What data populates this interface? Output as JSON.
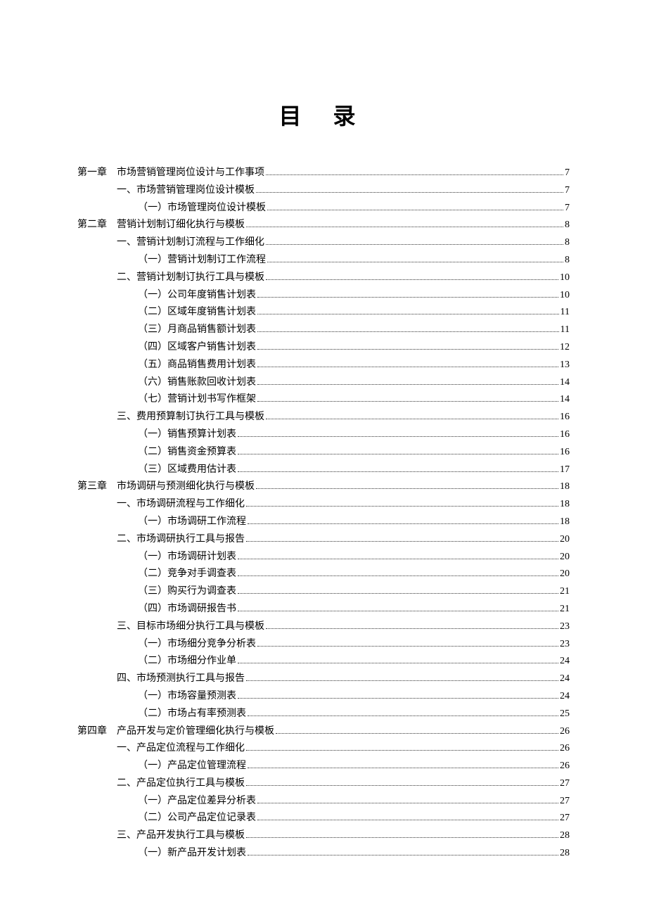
{
  "title": "目 录",
  "entries": [
    {
      "level": 1,
      "chapter": "第一章",
      "text": "市场营销管理岗位设计与工作事项",
      "page": "7"
    },
    {
      "level": 2,
      "chapter": "",
      "text": "一、市场营销管理岗位设计模板",
      "page": "7"
    },
    {
      "level": 3,
      "chapter": "",
      "text": "（一）市场管理岗位设计模板",
      "page": "7"
    },
    {
      "level": 1,
      "chapter": "第二章",
      "text": "营销计划制订细化执行与模板",
      "page": "8"
    },
    {
      "level": 2,
      "chapter": "",
      "text": "一、营销计划制订流程与工作细化",
      "page": "8"
    },
    {
      "level": 3,
      "chapter": "",
      "text": "（一）营销计划制订工作流程",
      "page": "8"
    },
    {
      "level": 2,
      "chapter": "",
      "text": "二、营销计划制订执行工具与模板",
      "page": "10"
    },
    {
      "level": 3,
      "chapter": "",
      "text": "（一）公司年度销售计划表",
      "page": "10"
    },
    {
      "level": 3,
      "chapter": "",
      "text": "（二）区域年度销售计划表",
      "page": "11"
    },
    {
      "level": 3,
      "chapter": "",
      "text": "（三）月商品销售额计划表",
      "page": "11"
    },
    {
      "level": 3,
      "chapter": "",
      "text": "（四）区域客户销售计划表",
      "page": "12"
    },
    {
      "level": 3,
      "chapter": "",
      "text": "（五）商品销售费用计划表",
      "page": "13"
    },
    {
      "level": 3,
      "chapter": "",
      "text": "（六）销售账款回收计划表",
      "page": "14"
    },
    {
      "level": 3,
      "chapter": "",
      "text": "（七）营销计划书写作框架",
      "page": "14"
    },
    {
      "level": 2,
      "chapter": "",
      "text": "三、费用预算制订执行工具与模板",
      "page": "16"
    },
    {
      "level": 3,
      "chapter": "",
      "text": "（一）销售预算计划表",
      "page": "16"
    },
    {
      "level": 3,
      "chapter": "",
      "text": "（二）销售资金预算表",
      "page": "16"
    },
    {
      "level": 3,
      "chapter": "",
      "text": "（三）区域费用估计表",
      "page": "17"
    },
    {
      "level": 1,
      "chapter": "第三章",
      "text": "市场调研与预测细化执行与模板",
      "page": "18"
    },
    {
      "level": 2,
      "chapter": "",
      "text": "一、市场调研流程与工作细化",
      "page": "18"
    },
    {
      "level": 3,
      "chapter": "",
      "text": "（一）市场调研工作流程",
      "page": "18"
    },
    {
      "level": 2,
      "chapter": "",
      "text": "二、市场调研执行工具与报告",
      "page": "20"
    },
    {
      "level": 3,
      "chapter": "",
      "text": "（一）市场调研计划表",
      "page": "20"
    },
    {
      "level": 3,
      "chapter": "",
      "text": "（二）竞争对手调查表",
      "page": "20"
    },
    {
      "level": 3,
      "chapter": "",
      "text": "（三）购买行为调查表",
      "page": "21"
    },
    {
      "level": 3,
      "chapter": "",
      "text": "（四）市场调研报告书",
      "page": "21"
    },
    {
      "level": 2,
      "chapter": "",
      "text": "三、目标市场细分执行工具与模板",
      "page": "23"
    },
    {
      "level": 3,
      "chapter": "",
      "text": "（一）市场细分竞争分析表",
      "page": "23"
    },
    {
      "level": 3,
      "chapter": "",
      "text": "（二）市场细分作业单",
      "page": "24"
    },
    {
      "level": 2,
      "chapter": "",
      "text": "四、市场预测执行工具与报告",
      "page": "24"
    },
    {
      "level": 3,
      "chapter": "",
      "text": "（一）市场容量预测表",
      "page": "24"
    },
    {
      "level": 3,
      "chapter": "",
      "text": "（二）市场占有率预测表",
      "page": "25"
    },
    {
      "level": 1,
      "chapter": "第四章",
      "text": "产品开发与定价管理细化执行与模板",
      "page": "26"
    },
    {
      "level": 2,
      "chapter": "",
      "text": "一、产品定位流程与工作细化",
      "page": "26"
    },
    {
      "level": 3,
      "chapter": "",
      "text": "（一）产品定位管理流程",
      "page": "26"
    },
    {
      "level": 2,
      "chapter": "",
      "text": "二、产品定位执行工具与模板",
      "page": "27"
    },
    {
      "level": 3,
      "chapter": "",
      "text": "（一）产品定位差异分析表",
      "page": "27"
    },
    {
      "level": 3,
      "chapter": "",
      "text": "（二）公司产品定位记录表",
      "page": "27"
    },
    {
      "level": 2,
      "chapter": "",
      "text": "三、产品开发执行工具与模板",
      "page": "28"
    },
    {
      "level": 3,
      "chapter": "",
      "text": "（一）新产品开发计划表",
      "page": "28"
    }
  ]
}
